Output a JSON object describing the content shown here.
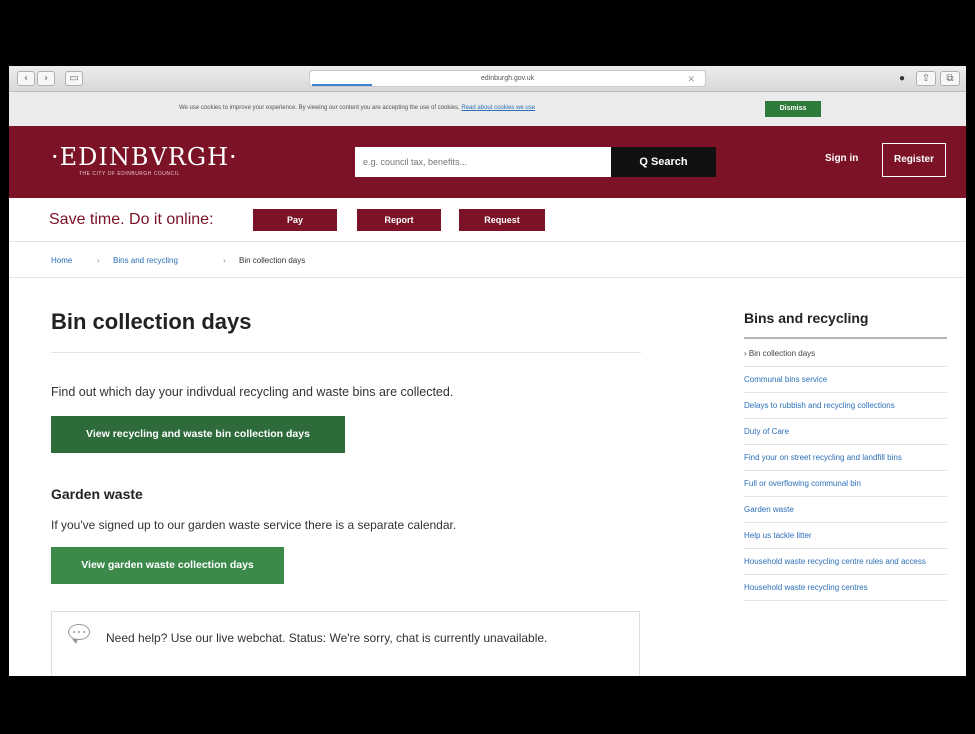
{
  "browser": {
    "url": "edinburgh.gov.uk",
    "back_glyph": "‹",
    "forward_glyph": "›",
    "clear_glyph": "✕"
  },
  "cookie": {
    "message": "We use cookies to improve your experience. By viewing our content you are accepting the use of cookies.",
    "link": "Read about cookies we use",
    "dismiss": "Dismiss"
  },
  "header": {
    "logo": "·EDINBVRGH·",
    "logo_sub": "THE CITY OF EDINBURGH COUNCIL",
    "search_placeholder": "e.g. council tax, benefits...",
    "search_label": "Q Search",
    "signin": "Sign in",
    "register": "Register"
  },
  "savebar": {
    "label": "Save time. Do it online:",
    "pay": "Pay",
    "report": "Report",
    "request": "Request"
  },
  "breadcrumb": {
    "home": "Home",
    "section": "Bins and recycling",
    "current": "Bin collection days",
    "sep": "›"
  },
  "main": {
    "title": "Bin collection days",
    "intro": "Find out which day your indivdual recycling and waste bins are collected.",
    "primary_button": "View recycling and waste bin collection days",
    "garden_heading": "Garden waste",
    "garden_text": "If you've signed up to our garden waste service there is a separate calendar.",
    "garden_button": "View garden waste collection days",
    "help_text": "Need help? Use our live webchat. Status: We're sorry, chat is currently unavailable."
  },
  "sidebar": {
    "title": "Bins and recycling",
    "items": [
      "› Bin collection days",
      "Communal bins service",
      "Delays to rubbish and recycling collections",
      "Duty of Care",
      "Find your on street recycling and landfill bins",
      "Full or overflowing communal bin",
      "Garden waste",
      "Help us tackle litter",
      "Household waste recycling centre rules and access",
      "Household waste recycling centres"
    ]
  },
  "colors": {
    "brand": "#7b1225",
    "green_dark": "#2d6b3a",
    "green": "#3b8a49",
    "link": "#2c6fb7"
  }
}
